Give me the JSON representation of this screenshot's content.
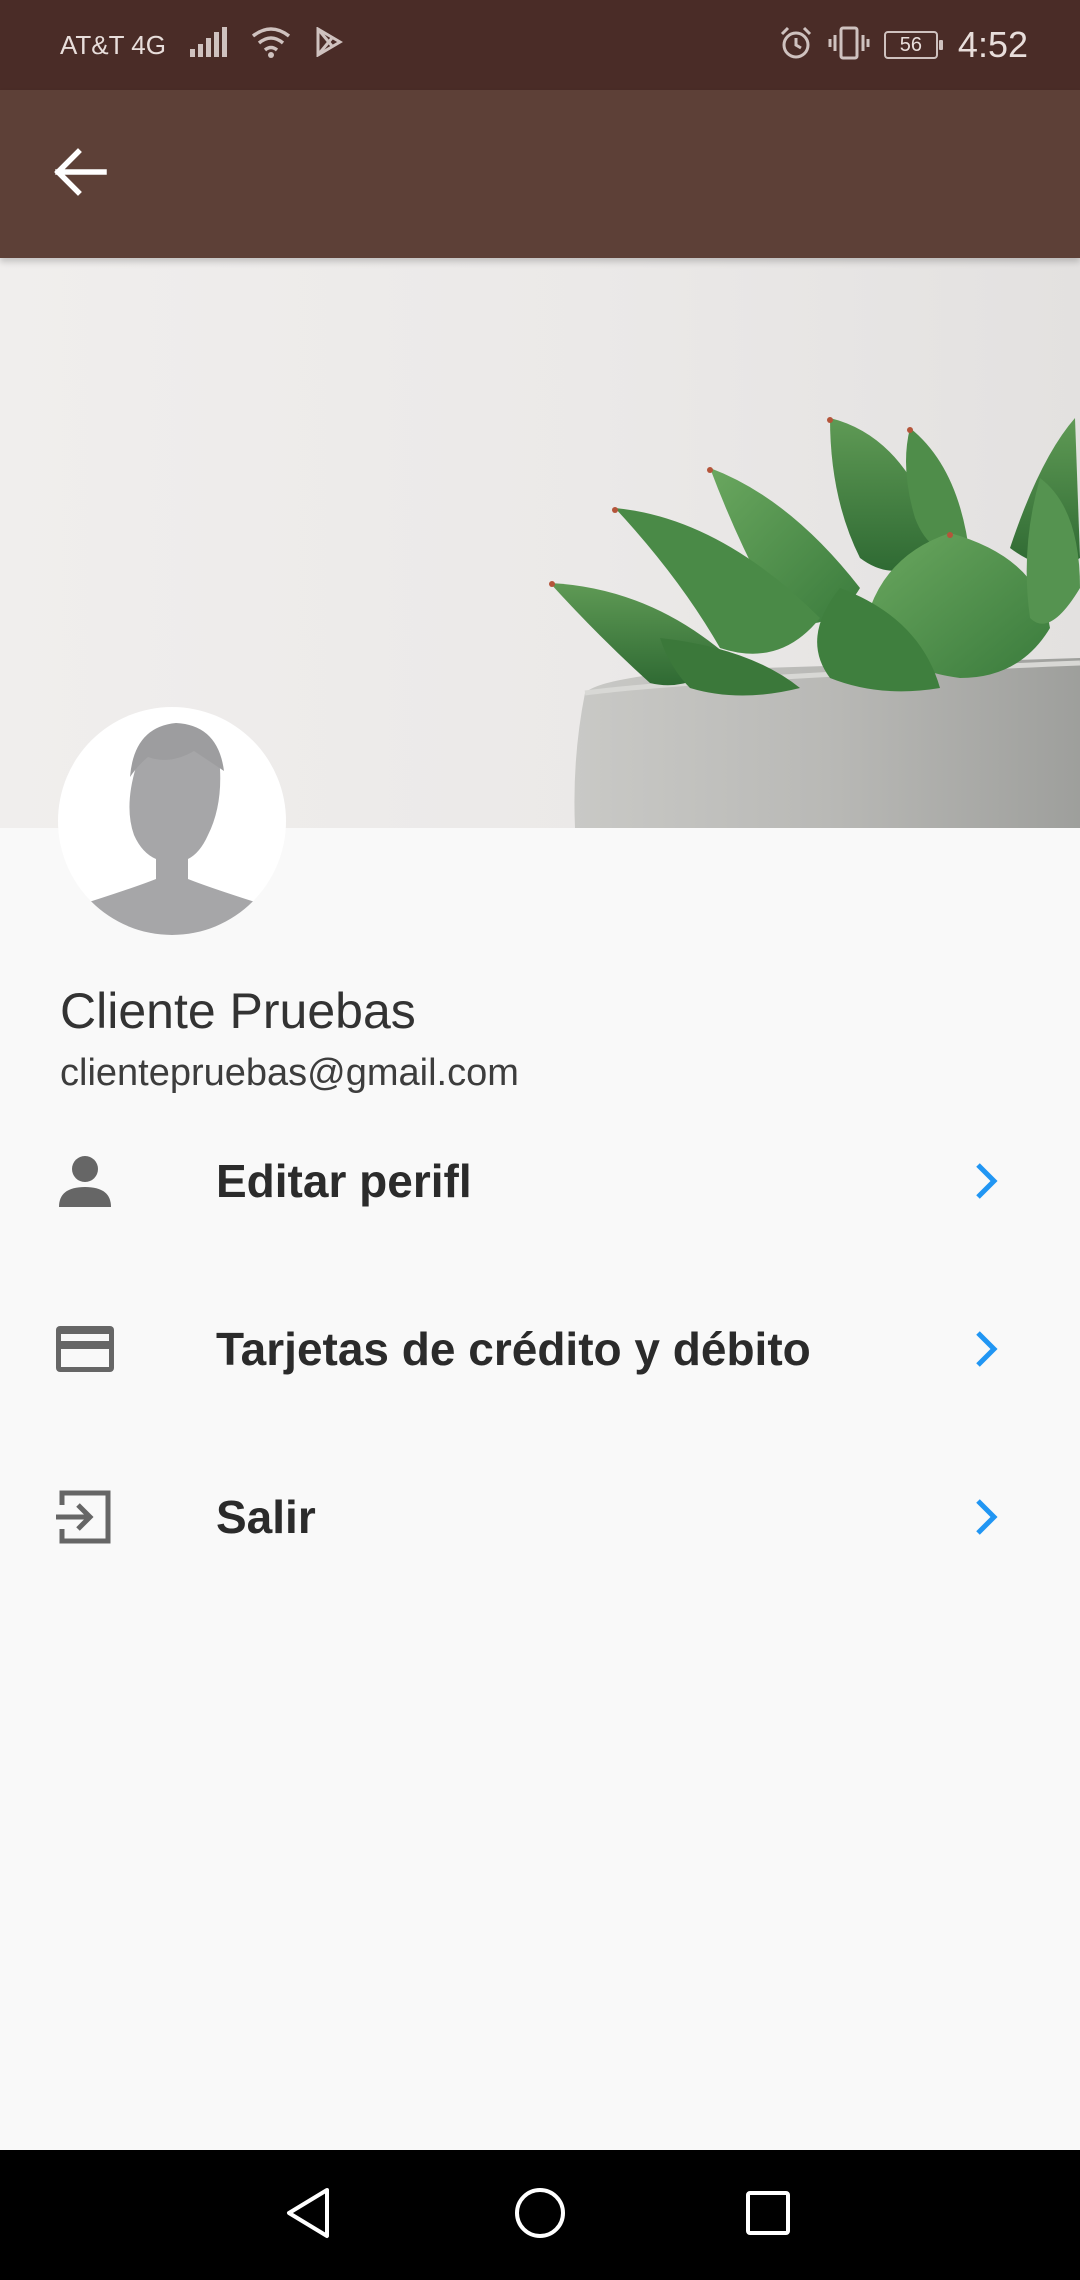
{
  "status_bar": {
    "carrier": "AT&T 4G",
    "battery": "56",
    "time": "4:52"
  },
  "app_bar": {
    "back_icon": "arrow-left-icon"
  },
  "profile": {
    "name": "Cliente Pruebas",
    "email": "clientepruebas@gmail.com"
  },
  "menu": {
    "items": [
      {
        "label": "Editar perifl",
        "icon": "person-icon"
      },
      {
        "label": "Tarjetas de crédito y débito",
        "icon": "credit-card-icon"
      },
      {
        "label": "Salir",
        "icon": "exit-icon"
      }
    ]
  },
  "colors": {
    "status_bar": "#4a2c27",
    "app_bar": "#5d4037",
    "chevron": "#2196f3",
    "background": "#f9f9f9"
  }
}
